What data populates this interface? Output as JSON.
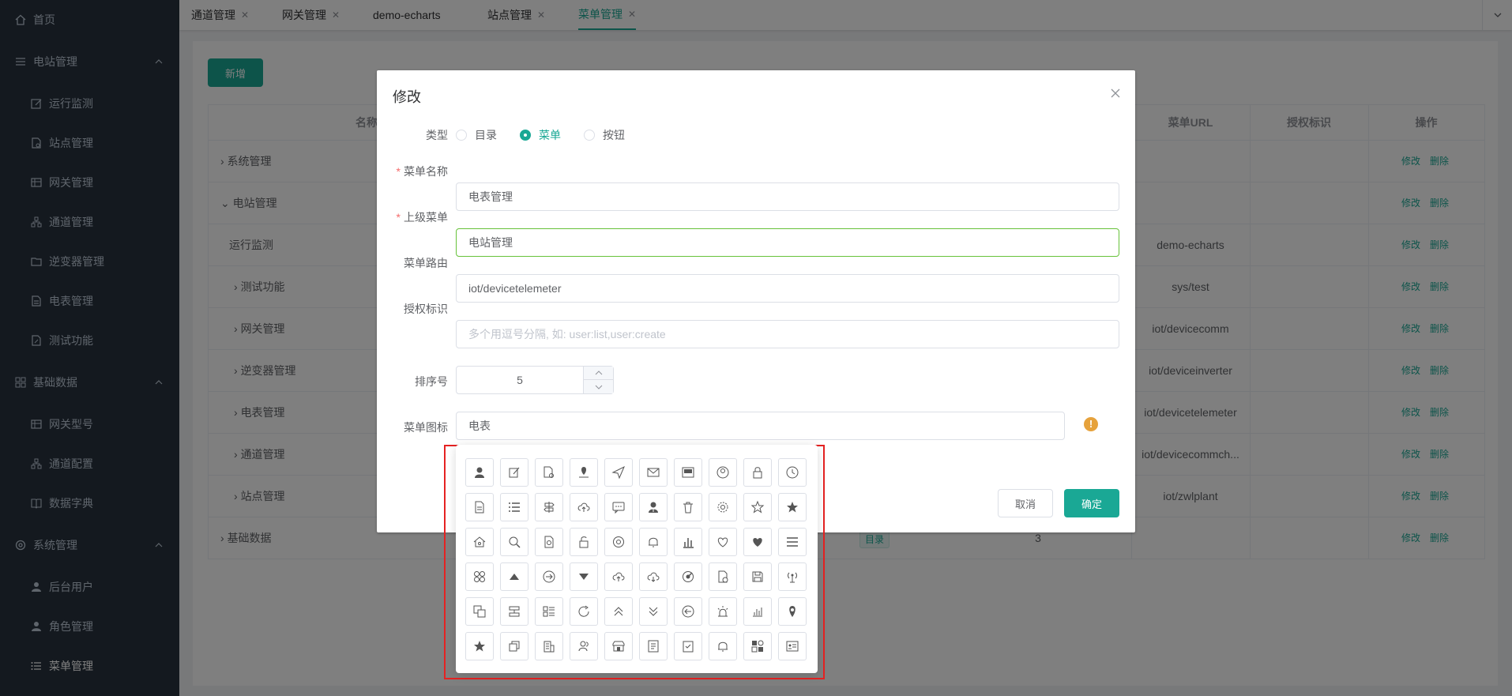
{
  "sidebar": {
    "home": "首页",
    "groups": [
      {
        "label": "电站管理",
        "items": [
          "运行监测",
          "站点管理",
          "网关管理",
          "通道管理",
          "逆变器管理",
          "电表管理",
          "测试功能"
        ]
      },
      {
        "label": "基础数据",
        "items": [
          "网关型号",
          "通道配置",
          "数据字典"
        ]
      },
      {
        "label": "系统管理",
        "items": [
          "后台用户",
          "角色管理",
          "菜单管理"
        ]
      }
    ]
  },
  "tabs": [
    {
      "label": "通道管理"
    },
    {
      "label": "网关管理"
    },
    {
      "label": "demo-echarts"
    },
    {
      "label": "站点管理"
    },
    {
      "label": "菜单管理",
      "active": true
    }
  ],
  "toolbar": {
    "add_label": "新增"
  },
  "table": {
    "headers": {
      "name": "名称",
      "url": "菜单URL",
      "perm": "授权标识",
      "ops": "操作"
    },
    "op_edit": "修改",
    "op_delete": "删除",
    "rows": [
      {
        "name": "系统管理",
        "url": ""
      },
      {
        "name": "电站管理",
        "url": ""
      },
      {
        "name": "运行监测",
        "url": "demo-echarts"
      },
      {
        "name": "测试功能",
        "url": "sys/test"
      },
      {
        "name": "网关管理",
        "url": "iot/devicecomm"
      },
      {
        "name": "逆变器管理",
        "url": "iot/deviceinverter"
      },
      {
        "name": "电表管理",
        "url": "iot/devicetelemeter"
      },
      {
        "name": "通道管理",
        "url": "iot/devicecommch..."
      },
      {
        "name": "站点管理",
        "url": "iot/zwlplant"
      },
      {
        "name": "基础数据",
        "url": "",
        "tag": "目录",
        "num": "3"
      }
    ]
  },
  "dialog": {
    "title": "修改",
    "type_label": "类型",
    "type_options": [
      "目录",
      "菜单",
      "按钮"
    ],
    "selected_type": "菜单",
    "name_label": "菜单名称",
    "name_value": "电表管理",
    "parent_label": "上级菜单",
    "parent_value": "电站管理",
    "route_label": "菜单路由",
    "route_value": "iot/devicetelemeter",
    "perm_label": "授权标识",
    "perm_placeholder": "多个用逗号分隔, 如: user:list,user:create",
    "order_label": "排序号",
    "order_value": "5",
    "icon_label": "菜单图标",
    "icon_value": "电表",
    "cancel": "取消",
    "ok": "确定"
  },
  "icon_picker": {
    "icons": [
      "user-icon",
      "edit-icon",
      "document-gear-icon",
      "map-pin-icon",
      "send-icon",
      "mail-icon",
      "newspaper-icon",
      "user-circle-icon",
      "lock-icon",
      "clock-icon",
      "document-icon",
      "list-icon",
      "signpost-icon",
      "cloud-upload-icon",
      "chat-icon",
      "agent-icon",
      "trash-icon",
      "gear-icon",
      "star-outline-icon",
      "star-icon",
      "house-icon",
      "search-icon",
      "document-search-icon",
      "unlock-icon",
      "settings-icon",
      "bell-icon",
      "bar-chart-icon",
      "heart-outline-icon",
      "heart-icon",
      "menu-icon",
      "grid-icon",
      "caret-up-icon",
      "arrow-right-circle-icon",
      "caret-down-icon",
      "cloud-upload-icon",
      "cloud-download-icon",
      "radar-icon",
      "document-clock-icon",
      "save-icon",
      "antenna-icon",
      "copy-icon",
      "server-icon",
      "detail-list-icon",
      "refresh-icon",
      "double-up-icon",
      "double-down-icon",
      "arrow-left-circle-icon",
      "alarm-icon",
      "stats-icon",
      "location-icon",
      "star-icon",
      "stack-icon",
      "building-icon",
      "users-icon",
      "shop-icon",
      "notes-icon",
      "clipboard-check-icon",
      "bell-icon",
      "apps-icon",
      "id-card-icon"
    ]
  }
}
